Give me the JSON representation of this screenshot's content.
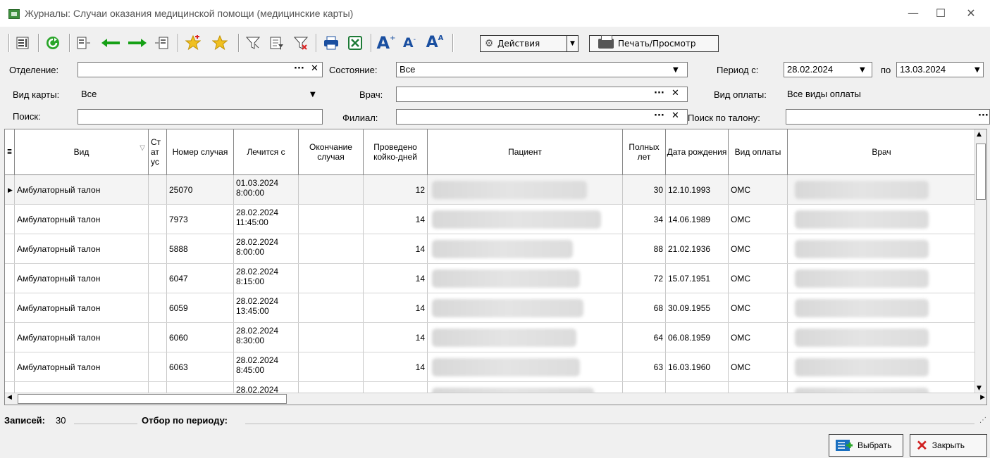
{
  "window": {
    "title": "Журналы: Случаи оказания медицинской помощи (медицинские карты)",
    "minimize": "—",
    "maximize": "☐",
    "close": "✕"
  },
  "toolbar": {
    "actions_label": "Действия",
    "print_label": "Печать/Просмотр"
  },
  "filters": {
    "department_label": "Отделение:",
    "department_value": "",
    "state_label": "Состояние:",
    "state_value": "Все",
    "period_from_label": "Период с:",
    "period_from": "28.02.2024",
    "period_to_label": "по",
    "period_to": "13.03.2024",
    "card_type_label": "Вид карты:",
    "card_type_value": "Все",
    "doctor_label": "Врач:",
    "doctor_value": "",
    "payment_label": "Вид оплаты:",
    "payment_value": "Все виды оплаты",
    "search_label": "Поиск:",
    "search_value": "",
    "branch_label": "Филиал:",
    "branch_value": "",
    "ticket_search_label": "Поиск по талону:",
    "ticket_search_value": "",
    "ellipsis": "···",
    "clear": "✕"
  },
  "table": {
    "headers": {
      "type": "Вид",
      "status": "Ст ат ус",
      "case_no": "Номер случая",
      "treated_from": "Лечится с",
      "case_end": "Окончание случая",
      "bed_days": "Проведено койко-дней",
      "patient": "Пациент",
      "age": "Полных лет",
      "birth_date": "Дата рождения",
      "payment": "Вид оплаты",
      "doctor": "Врач"
    },
    "rows": [
      {
        "type": "Амбулаторный талон",
        "case_no": "25070",
        "treated_from": "01.03.2024 8:00:00",
        "bed_days": "12",
        "age": "30",
        "birth_date": "12.10.1993",
        "payment": "ОМС"
      },
      {
        "type": "Амбулаторный талон",
        "case_no": "7973",
        "treated_from": "28.02.2024 11:45:00",
        "bed_days": "14",
        "age": "34",
        "birth_date": "14.06.1989",
        "payment": "ОМС"
      },
      {
        "type": "Амбулаторный талон",
        "case_no": "5888",
        "treated_from": "28.02.2024 8:00:00",
        "bed_days": "14",
        "age": "88",
        "birth_date": "21.02.1936",
        "payment": "ОМС"
      },
      {
        "type": "Амбулаторный талон",
        "case_no": "6047",
        "treated_from": "28.02.2024 8:15:00",
        "bed_days": "14",
        "age": "72",
        "birth_date": "15.07.1951",
        "payment": "ОМС"
      },
      {
        "type": "Амбулаторный талон",
        "case_no": "6059",
        "treated_from": "28.02.2024 13:45:00",
        "bed_days": "14",
        "age": "68",
        "birth_date": "30.09.1955",
        "payment": "ОМС"
      },
      {
        "type": "Амбулаторный талон",
        "case_no": "6060",
        "treated_from": "28.02.2024 8:30:00",
        "bed_days": "14",
        "age": "64",
        "birth_date": "06.08.1959",
        "payment": "ОМС"
      },
      {
        "type": "Амбулаторный талон",
        "case_no": "6063",
        "treated_from": "28.02.2024 8:45:00",
        "bed_days": "14",
        "age": "63",
        "birth_date": "16.03.1960",
        "payment": "ОМС"
      },
      {
        "type": "",
        "case_no": "",
        "treated_from": "28.02.2024",
        "bed_days": "",
        "age": "",
        "birth_date": "",
        "payment": ""
      }
    ]
  },
  "status": {
    "records_label": "Записей:",
    "records_count": "30",
    "period_filter_label": "Отбор по периоду:"
  },
  "buttons": {
    "select_label": "Выбрать",
    "close_label": "Закрыть"
  }
}
